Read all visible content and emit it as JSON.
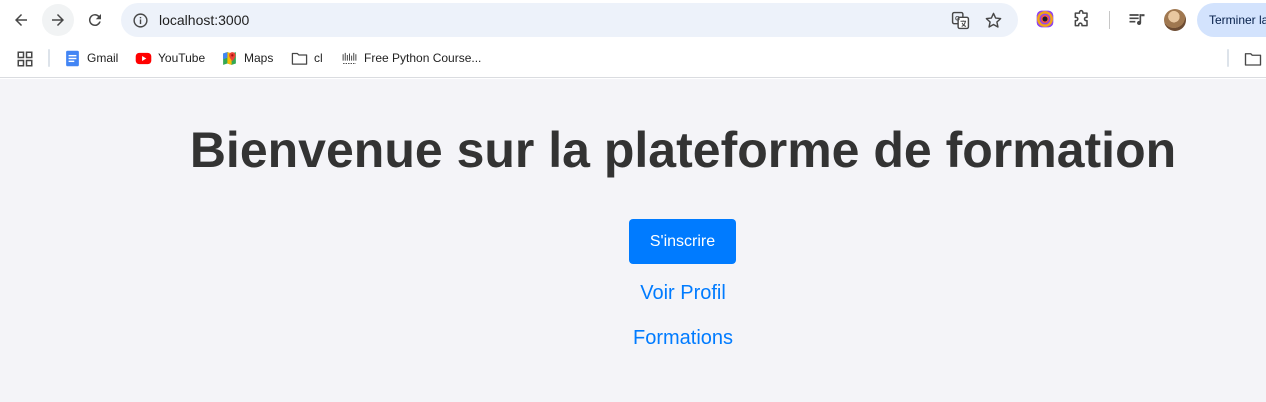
{
  "browser": {
    "url": "localhost:3000",
    "finish_button_label": "Terminer la",
    "icons": {
      "back": "arrow-left",
      "forward": "arrow-right",
      "reload": "reload",
      "site_info": "info-circle",
      "translate": "translate",
      "bookmark_star": "star-outline",
      "extension": "puzzle",
      "media": "media-queue",
      "profile": "avatar"
    }
  },
  "bookmarks": [
    {
      "label": "Gmail",
      "icon": "gmail-icon"
    },
    {
      "label": "YouTube",
      "icon": "youtube-icon"
    },
    {
      "label": "Maps",
      "icon": "maps-icon"
    },
    {
      "label": "cl",
      "icon": "folder-icon"
    },
    {
      "label": "Free Python Course...",
      "icon": "site-favicon"
    }
  ],
  "page": {
    "headline": "Bienvenue sur la plateforme de formation",
    "signup_label": "S'inscrire",
    "profile_link": "Voir Profil",
    "formations_link": "Formations"
  },
  "colors": {
    "accent": "#007bff",
    "page_background": "#f4f4f8",
    "headline": "#333333"
  }
}
